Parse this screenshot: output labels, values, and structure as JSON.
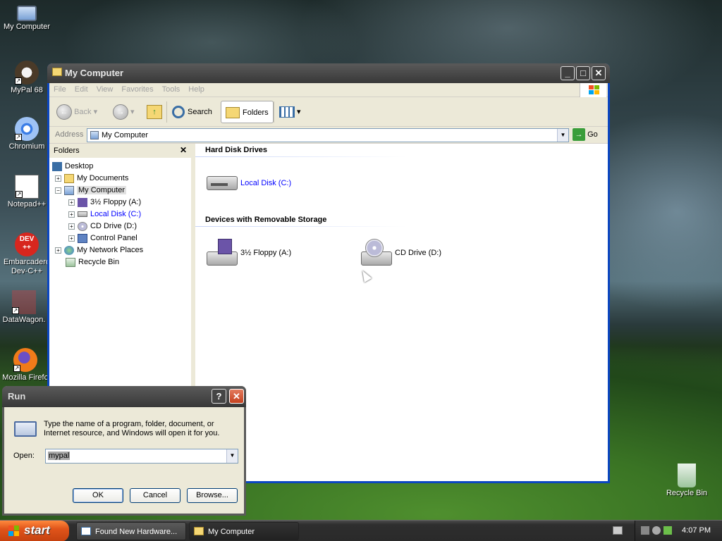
{
  "desktop": {
    "icons": [
      {
        "label": "My Computer"
      },
      {
        "label": "MyPal 68"
      },
      {
        "label": "Chromium"
      },
      {
        "label": "Notepad++"
      },
      {
        "label": "Embarcadero Dev-C++",
        "line1": "Embarcadero",
        "line2": "Dev-C++"
      },
      {
        "label": "DataWagon."
      },
      {
        "label": "Mozilla Firefo"
      },
      {
        "label": "Recycle Bin"
      }
    ]
  },
  "explorer": {
    "title": "My Computer",
    "menu": [
      "File",
      "Edit",
      "View",
      "Favorites",
      "Tools",
      "Help"
    ],
    "toolbar": {
      "back": "Back",
      "search": "Search",
      "folders": "Folders"
    },
    "address": {
      "label": "Address",
      "value": "My Computer",
      "go": "Go"
    },
    "folders_pane": {
      "title": "Folders",
      "tree": [
        {
          "label": "Desktop"
        },
        {
          "label": "My Documents"
        },
        {
          "label": "My Computer"
        },
        {
          "label": "3½ Floppy (A:)"
        },
        {
          "label": "Local Disk (C:)"
        },
        {
          "label": "CD Drive (D:)"
        },
        {
          "label": "Control Panel"
        },
        {
          "label": "My Network Places"
        },
        {
          "label": "Recycle Bin"
        }
      ]
    },
    "content": {
      "groups": [
        {
          "title": "Hard Disk Drives",
          "items": [
            "Local Disk (C:)"
          ]
        },
        {
          "title": "Devices with Removable Storage",
          "items": [
            "3½ Floppy (A:)",
            "CD Drive (D:)"
          ]
        }
      ]
    }
  },
  "run_dialog": {
    "title": "Run",
    "help": "?",
    "close": "✕",
    "description": "Type the name of a program, folder, document, or Internet resource, and Windows will open it for you.",
    "open_label": "Open:",
    "open_value": "mypal",
    "ok": "OK",
    "cancel": "Cancel",
    "browse": "Browse..."
  },
  "taskbar": {
    "start": "start",
    "tasks": [
      "Found New Hardware...",
      "My Computer"
    ],
    "clock": "4:07 PM"
  },
  "colors": {
    "title_active": "#383838",
    "start_button": "#e0541a",
    "link_blue": "#0000ff"
  }
}
